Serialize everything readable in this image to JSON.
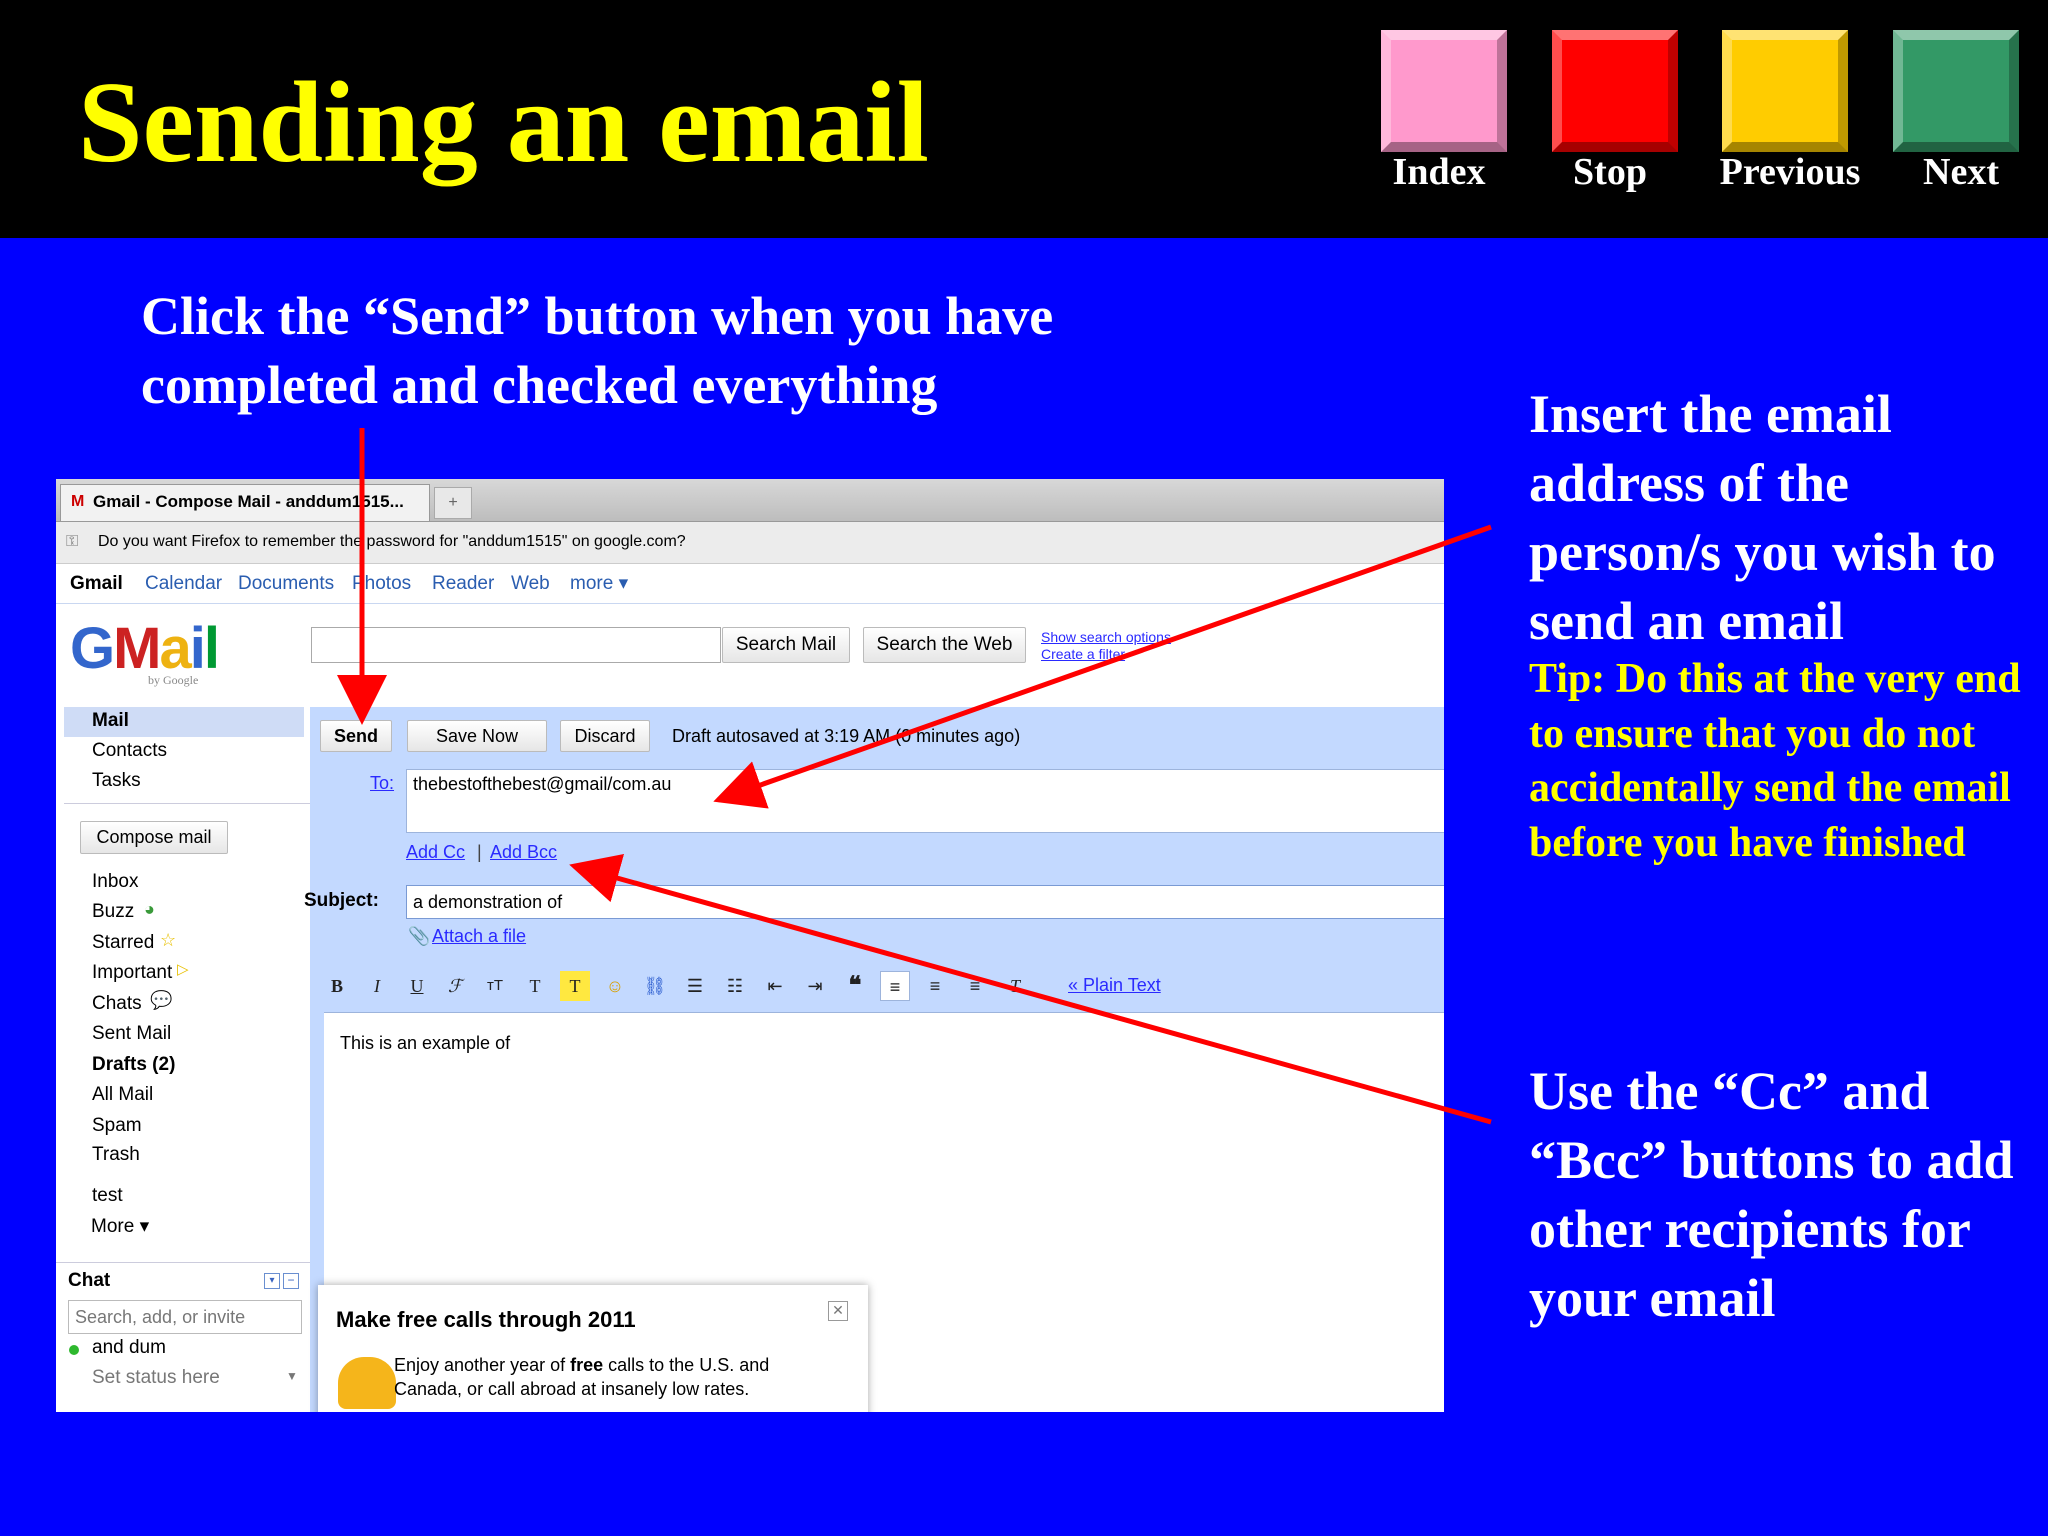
{
  "slide": {
    "title": "Sending an email",
    "nav_buttons": [
      {
        "label": "Index",
        "color": "#ff99cc"
      },
      {
        "label": "Stop",
        "color": "#ff0000"
      },
      {
        "label": "Previous",
        "color": "#ffcc00"
      },
      {
        "label": "Next",
        "color": "#339966"
      }
    ],
    "instruction_send": "Click the “Send” button when you have completed and checked everything",
    "instruction_to": "Insert the email address of the person/s you wish to send an email",
    "tip": "Tip: Do this at the very end to ensure that you do  not accidentally send the email before you have finished",
    "instruction_cc": "Use the “Cc” and “Bcc” buttons to add other recipients for your email",
    "colors": {
      "background": "#0000ff",
      "header": "#000000",
      "title": "#ffff00",
      "tip": "#ffff00",
      "arrow": "#ff0000"
    }
  },
  "browser": {
    "tab_title": "Gmail - Compose Mail - anddum1515...",
    "new_tab_icon": "plus-icon",
    "password_prompt": "Do you want Firefox to remember the password for \"anddum1515\" on google.com?"
  },
  "gbar": {
    "items": [
      "Gmail",
      "Calendar",
      "Documents",
      "Photos",
      "Reader",
      "Web",
      "more ▾"
    ]
  },
  "gmail": {
    "logo": "Gmail",
    "logo_sub": "by Google",
    "search_mail": "Search Mail",
    "search_web": "Search the Web",
    "show_search_options": "Show search options",
    "create_filter": "Create a filter",
    "nav_top": [
      "Mail",
      "Contacts",
      "Tasks"
    ],
    "compose_mail": "Compose mail",
    "labels": [
      "Inbox",
      "Buzz",
      "Starred",
      "Important",
      "Chats",
      "Sent Mail",
      "Drafts (2)",
      "All Mail",
      "Spam",
      "Trash",
      "test",
      "More ▾"
    ],
    "chat": {
      "header": "Chat",
      "search_placeholder": "Search, add, or invite",
      "user": "and dum",
      "status": "Set status here"
    },
    "compose": {
      "send": "Send",
      "save_now": "Save Now",
      "discard": "Discard",
      "draft_status": "Draft autosaved at 3:19 AM (0 minutes ago)",
      "to_label": "To:",
      "to_value": "thebestofthebest@gmail/com.au",
      "add_cc": "Add Cc",
      "separator": "|",
      "add_bcc": "Add Bcc",
      "subject_label": "Subject:",
      "subject_value": "a demonstration of",
      "attach": "Attach a file",
      "plain_text": "« Plain Text",
      "body": "This is an example of"
    },
    "popup": {
      "title": "Make free calls through 2011",
      "text_before": "Enjoy another year of ",
      "text_bold": "free",
      "text_after": " calls to the U.S. and Canada, or call abroad at insanely low rates."
    }
  }
}
